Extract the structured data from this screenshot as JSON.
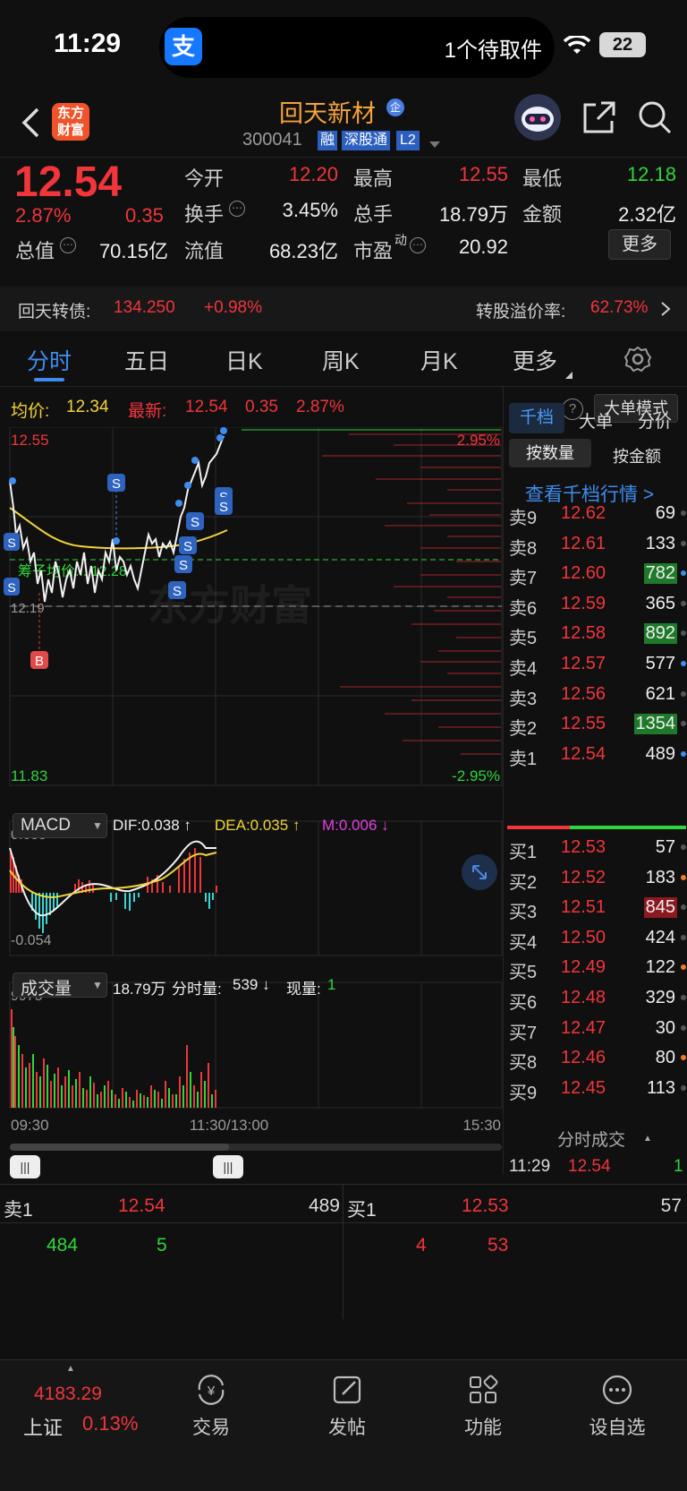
{
  "status": {
    "time": "11:29",
    "pickup": "1个待取件",
    "battery": "22",
    "alipay": "支"
  },
  "nav": {
    "name": "回天新材",
    "code": "300041",
    "tag_rong": "融",
    "tag_sgt": "深股通",
    "tag_l2": "L2",
    "logo": "东方财富",
    "tag_q": "企"
  },
  "quote": {
    "price": "12.54",
    "pct": "2.87%",
    "chg": "0.35",
    "open_l": "今开",
    "open": "12.20",
    "high_l": "最高",
    "high": "12.55",
    "low_l": "最低",
    "low": "12.18",
    "turn_l": "换手",
    "turn": "3.45%",
    "vol_l": "总手",
    "vol": "18.79万",
    "amt_l": "金额",
    "amt": "2.32亿",
    "mcap_l": "总值",
    "mcap": "70.15亿",
    "fcap_l": "流值",
    "fcap": "68.23亿",
    "pe_l": "市盈",
    "pe_sup": "动",
    "pe": "20.92",
    "more": "更多"
  },
  "cb": {
    "label": "回天转债:",
    "price": "134.250",
    "chg": "+0.98%",
    "prem_label": "转股溢价率:",
    "prem": "62.73%"
  },
  "tabs": [
    "分时",
    "五日",
    "日K",
    "周K",
    "月K",
    "更多"
  ],
  "chart": {
    "avg_l": "均价:",
    "avg": "12.34",
    "latest_l": "最新:",
    "latest": "12.54",
    "chg": "0.35",
    "pct": "2.87%",
    "mode": "大单模式",
    "ymax": "12.55",
    "ymin": "11.83",
    "pmax": "2.95%",
    "pmin": "-2.95%",
    "pre": "12.19",
    "cyq": "筹子均价... 12.28",
    "watermark": "东方财富",
    "macd_sel": "MACD",
    "dif": "DIF:0.038 ↑",
    "dea": "DEA:0.035 ↑",
    "m": "M:0.006 ↓",
    "macd_max": "0.055",
    "macd_min": "-0.054",
    "vol_sel": "成交量",
    "vol_total": "18.79万",
    "vol_min_l": "分时量:",
    "vol_min": "539 ↓",
    "vol_now_l": "现量:",
    "vol_now": "1",
    "vol_max": "9975",
    "t_start": "09:30",
    "t_mid": "11:30/13:00",
    "t_end": "15:30"
  },
  "depth": {
    "tabs": [
      "千档",
      "大单",
      "分价"
    ],
    "sub": [
      "按数量",
      "按金额"
    ],
    "link": "查看千档行情 >",
    "sells": [
      {
        "l": "卖9",
        "p": "12.62",
        "v": "69"
      },
      {
        "l": "卖8",
        "p": "12.61",
        "v": "133"
      },
      {
        "l": "卖7",
        "p": "12.60",
        "v": "782"
      },
      {
        "l": "卖6",
        "p": "12.59",
        "v": "365"
      },
      {
        "l": "卖5",
        "p": "12.58",
        "v": "892"
      },
      {
        "l": "卖4",
        "p": "12.57",
        "v": "577"
      },
      {
        "l": "卖3",
        "p": "12.56",
        "v": "621"
      },
      {
        "l": "卖2",
        "p": "12.55",
        "v": "1354"
      },
      {
        "l": "卖1",
        "p": "12.54",
        "v": "489"
      }
    ],
    "buys": [
      {
        "l": "买1",
        "p": "12.53",
        "v": "57"
      },
      {
        "l": "买2",
        "p": "12.52",
        "v": "183"
      },
      {
        "l": "买3",
        "p": "12.51",
        "v": "845"
      },
      {
        "l": "买4",
        "p": "12.50",
        "v": "424"
      },
      {
        "l": "买5",
        "p": "12.49",
        "v": "122"
      },
      {
        "l": "买6",
        "p": "12.48",
        "v": "329"
      },
      {
        "l": "买7",
        "p": "12.47",
        "v": "30"
      },
      {
        "l": "买8",
        "p": "12.46",
        "v": "80"
      },
      {
        "l": "买9",
        "p": "12.45",
        "v": "113"
      }
    ],
    "tick_title": "分时成交",
    "tick_time": "11:29",
    "tick_price": "12.54",
    "tick_vol": "1"
  },
  "order": {
    "sell_l": "卖1",
    "sell_p": "12.54",
    "sell_v": "489",
    "sell_a": "484",
    "sell_b": "5",
    "buy_l": "买1",
    "buy_p": "12.53",
    "buy_v": "57",
    "buy_a": "4",
    "buy_b": "53"
  },
  "bottom": {
    "index_val": "4183.29",
    "index_name": "上证",
    "index_pct": "0.13%",
    "trade": "交易",
    "post": "发帖",
    "func": "功能",
    "watch": "设自选"
  }
}
